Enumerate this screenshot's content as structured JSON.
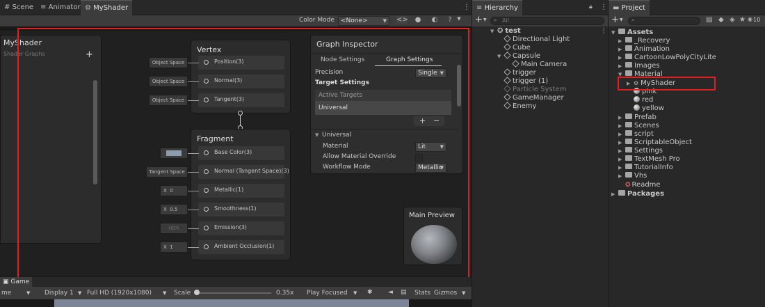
{
  "scene_tabs": {
    "scene": "Scene",
    "animator": "Animator",
    "myshader": "MyShader"
  },
  "toolbar": {
    "color_mode_label": "Color Mode",
    "color_mode_value": "<None>"
  },
  "blackboard": {
    "title": "MyShader",
    "subtitle": "Shader Graphs",
    "add": "+"
  },
  "vertex": {
    "title": "Vertex",
    "ports": [
      {
        "input": "Object Space",
        "label": "Position(3)"
      },
      {
        "input": "Object Space",
        "label": "Normal(3)"
      },
      {
        "input": "Object Space",
        "label": "Tangent(3)"
      }
    ]
  },
  "fragment": {
    "title": "Fragment",
    "ports": [
      {
        "input": "",
        "label": "Base Color(3)"
      },
      {
        "input": "Tangent Space",
        "label": "Normal (Tangent Space)(3)"
      },
      {
        "input_x": "X",
        "input": "0",
        "label": "Metallic(1)"
      },
      {
        "input_x": "X",
        "input": "0.5",
        "label": "Smoothness(1)"
      },
      {
        "input": "HDR",
        "label": "Emission(3)"
      },
      {
        "input_x": "X",
        "input": "1",
        "label": "Ambient Occlusion(1)"
      }
    ]
  },
  "inspector": {
    "title": "Graph Inspector",
    "tab_node": "Node Settings",
    "tab_graph": "Graph Settings",
    "precision_label": "Precision",
    "precision_value": "Single",
    "target_settings": "Target Settings",
    "active_targets": "Active Targets",
    "universal_item": "Universal",
    "add": "+",
    "remove": "−",
    "universal_section": "Universal",
    "material_label": "Material",
    "material_value": "Lit",
    "override_label": "Allow Material Override",
    "workflow_label": "Workflow Mode",
    "workflow_value": "Metallic"
  },
  "main_preview": {
    "title": "Main Preview"
  },
  "game_bar": {
    "tab": "Game",
    "game_cut": "me",
    "display": "Display 1",
    "resolution": "Full HD (1920x1080)",
    "scale_label": "Scale",
    "scale_value": "0.35x",
    "play_focused": "Play Focused",
    "stats": "Stats",
    "gizmos": "Gizmos"
  },
  "hierarchy": {
    "tab": "Hierarchy",
    "search_placeholder": "All",
    "add": "+",
    "scene": "test",
    "items": [
      {
        "label": "Directional Light",
        "depth": 1,
        "inactive": false
      },
      {
        "label": "Cube",
        "depth": 1,
        "inactive": false
      },
      {
        "label": "Capsule",
        "depth": 1,
        "inactive": false,
        "expanded": true
      },
      {
        "label": "Main Camera",
        "depth": 2,
        "inactive": false
      },
      {
        "label": "trigger",
        "depth": 1,
        "inactive": false
      },
      {
        "label": "trigger (1)",
        "depth": 1,
        "inactive": false
      },
      {
        "label": "Particle System",
        "depth": 1,
        "inactive": true
      },
      {
        "label": "GameManager",
        "depth": 1,
        "inactive": false
      },
      {
        "label": "Enemy",
        "depth": 1,
        "inactive": false
      }
    ]
  },
  "project": {
    "tab": "Project",
    "add": "+",
    "badge": "10",
    "assets": "Assets",
    "folders": [
      "_Recovery",
      "Animation",
      "CartoonLowPolyCityLite",
      "Images",
      "Material"
    ],
    "material_children": [
      "MyShader",
      "pink",
      "red",
      "yellow"
    ],
    "folders_after": [
      "Prefab",
      "Scenes",
      "script",
      "ScriptableObject",
      "Settings",
      "TextMesh Pro",
      "TutorialInfo",
      "Vhs"
    ],
    "readme": "Readme",
    "packages": "Packages"
  },
  "colors": {
    "highlight_red": "#e02020",
    "panel_bg": "#282828",
    "graph_bg": "#202020"
  }
}
